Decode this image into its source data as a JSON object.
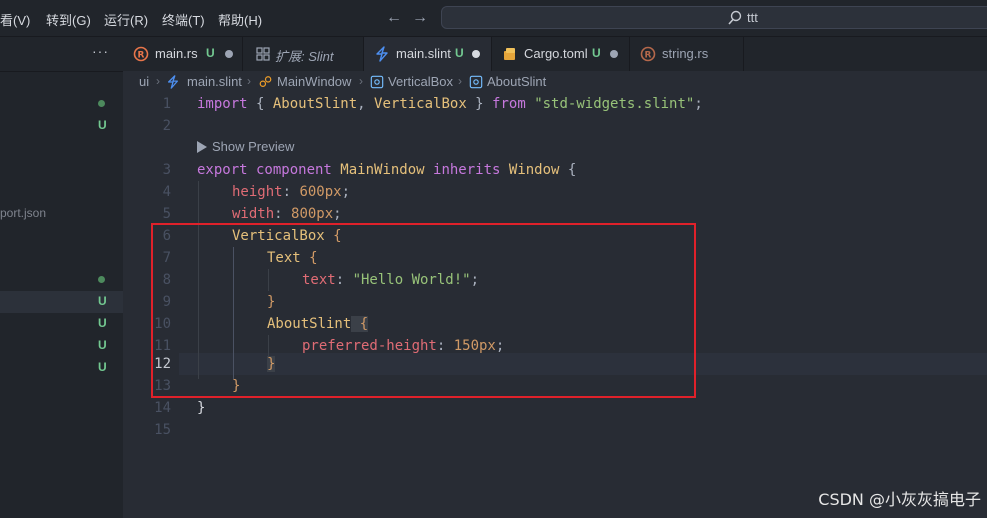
{
  "menubar": {
    "items": [
      "看(V)",
      "转到(G)",
      "运行(R)",
      "终端(T)",
      "帮助(H)"
    ],
    "search": "ttt"
  },
  "sidebar": {
    "more": "···",
    "rows": [
      {
        "status": "dot"
      },
      {
        "status": "U"
      },
      {
        "text": "port.json"
      },
      {
        "status": "dot"
      },
      {
        "status": "U"
      },
      {
        "status": "U"
      },
      {
        "status": "U"
      },
      {
        "status": "U"
      }
    ]
  },
  "tabs": [
    {
      "label": "main.rs",
      "status": "U",
      "icon": "rust-icon",
      "color": "#d4d7dd"
    },
    {
      "label": "扩展: Slint",
      "icon": "extension-icon",
      "color": "#9da5b4"
    },
    {
      "label": "main.slint",
      "status": "U",
      "icon": "slint-icon",
      "color": "#d4d7dd",
      "active": true
    },
    {
      "label": "Cargo.toml",
      "status": "U",
      "icon": "cargo-icon",
      "color": "#d4d7dd"
    },
    {
      "label": "string.rs",
      "icon": "rust-icon",
      "color": "#9da5b4"
    }
  ],
  "breadcrumb": [
    "ui",
    "main.slint",
    "MainWindow",
    "VerticalBox",
    "AboutSlint"
  ],
  "editor": {
    "line_numbers": [
      "1",
      "2",
      "3",
      "4",
      "5",
      "6",
      "7",
      "8",
      "9",
      "10",
      "11",
      "12",
      "13",
      "14",
      "15"
    ],
    "current_line": "12",
    "codelens": "Show Preview",
    "lines": {
      "l1": {
        "kw1": "import",
        "p1": " { ",
        "t1": "AboutSlint",
        "p2": ", ",
        "t2": "VerticalBox",
        "p3": " } ",
        "kw2": "from",
        "s": " \"std-widgets.slint\"",
        "p4": ";"
      },
      "l3": {
        "kw1": "export",
        "kw2": " component ",
        "t1": "MainWindow",
        "kw3": " inherits ",
        "t2": "Window",
        "p1": " {"
      },
      "l4": {
        "pr": "height",
        "p1": ": ",
        "n": "600px",
        "p2": ";"
      },
      "l5": {
        "pr": "width",
        "p1": ": ",
        "n": "800px",
        "p2": ";"
      },
      "l6": {
        "t": "VerticalBox",
        "b": " {"
      },
      "l7": {
        "t": "Text",
        "b": " {"
      },
      "l8": {
        "pr": "text",
        "p1": ": ",
        "s": "\"Hello World!\"",
        "p2": ";"
      },
      "l9": {
        "b": "}"
      },
      "l10": {
        "t": "AboutSlint",
        "b": " {"
      },
      "l11": {
        "pr": "preferred-height",
        "p1": ": ",
        "n": "150px",
        "p2": ";"
      },
      "l12": {
        "b": "}"
      },
      "l13": {
        "b": "}"
      },
      "l14": {
        "b": "}"
      }
    }
  },
  "watermark": "CSDN @小灰灰搞电子",
  "colors": {
    "highlight_box": "#e0212a",
    "git_untracked": "#73c991"
  }
}
